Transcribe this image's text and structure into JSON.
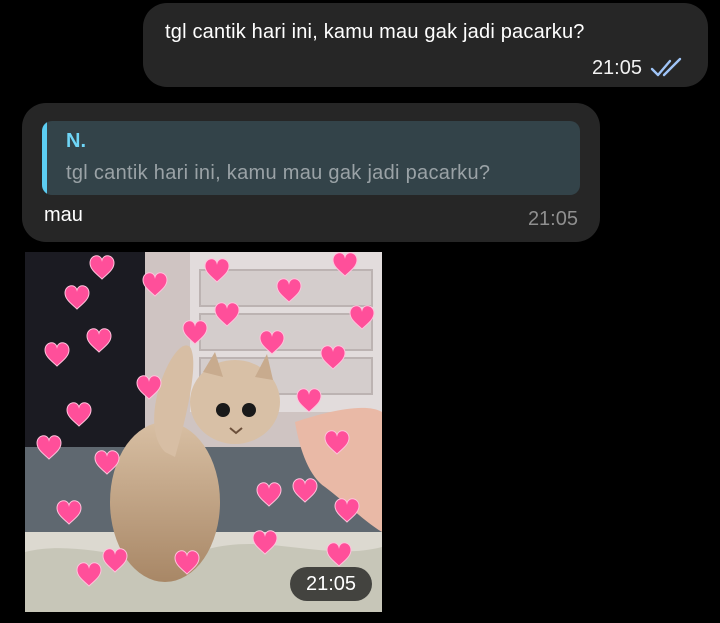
{
  "outgoing": {
    "text": "tgl cantik hari ini, kamu mau gak jadi pacarku?",
    "time": "21:05",
    "status_icon": "double-check-icon"
  },
  "incoming": {
    "reply": {
      "name": "N.",
      "quote": "tgl cantik hari ini, kamu mau gak jadi pacarku?"
    },
    "text": "mau",
    "time": "21:05"
  },
  "photo_message": {
    "time": "21:05"
  },
  "colors": {
    "background": "#000000",
    "bubble": "#262626",
    "reply_bg": "#334349",
    "reply_accent": "#5ccdf2",
    "check": "#9fc4f7",
    "heart": "#ff4f9a"
  }
}
